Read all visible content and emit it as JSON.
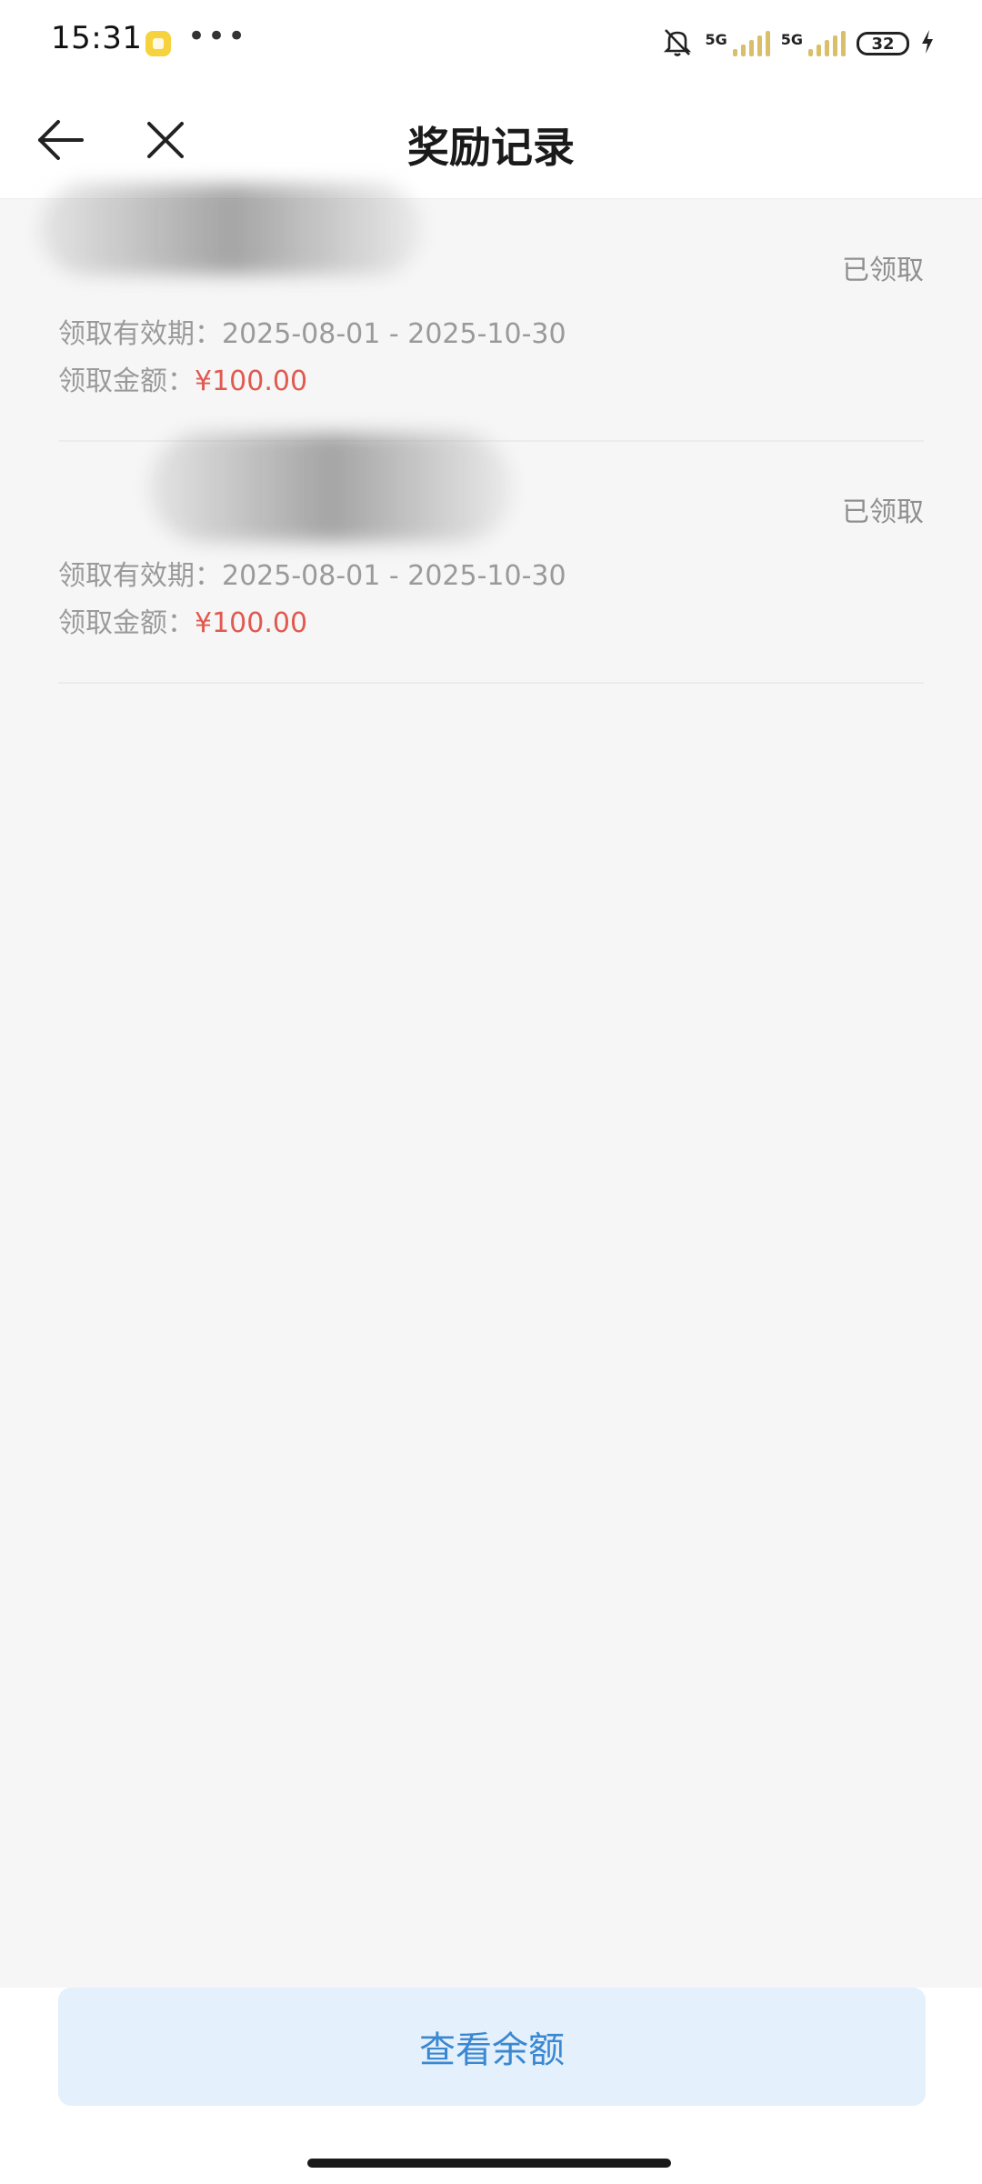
{
  "status_bar": {
    "time": "15:31",
    "more": "•••",
    "sim1_label": "5G",
    "sim2_label": "5G",
    "battery": "32"
  },
  "header": {
    "title": "奖励记录"
  },
  "records": [
    {
      "status": "已领取",
      "validity_label": "领取有效期：",
      "validity_value": "2025-08-01 - 2025-10-30",
      "amount_label": "领取金额：",
      "amount_value": "¥100.00"
    },
    {
      "status": "已领取",
      "validity_label": "领取有效期：",
      "validity_value": "2025-08-01 - 2025-10-30",
      "amount_label": "领取金额：",
      "amount_value": "¥100.00"
    }
  ],
  "bottom": {
    "button_label": "查看余额"
  },
  "colors": {
    "amount": "#e05a50",
    "button_bg": "#e4f0fb",
    "button_text": "#3a88d2",
    "page_bg": "#f6f6f6"
  }
}
